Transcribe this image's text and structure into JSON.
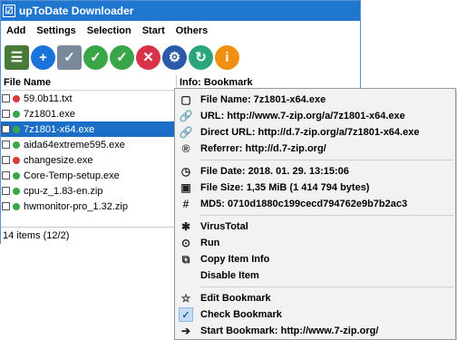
{
  "window": {
    "title": "upToDate Downloader"
  },
  "menubar": {
    "items": [
      "Add",
      "Settings",
      "Selection",
      "Start",
      "Others"
    ]
  },
  "toolbar": {
    "buttons": [
      {
        "icon": "list-icon",
        "color": "#4a7a3a"
      },
      {
        "icon": "add-icon",
        "color": "#1a73d9"
      },
      {
        "icon": "check-list-icon",
        "color": "#7a8a9a"
      },
      {
        "icon": "checkmark-icon",
        "color": "#3aa64a"
      },
      {
        "icon": "checkmark-icon",
        "color": "#3aa64a"
      },
      {
        "icon": "delete-icon",
        "color": "#d9334a"
      },
      {
        "icon": "settings-icon",
        "color": "#2a5aa8"
      },
      {
        "icon": "refresh-icon",
        "color": "#2aa67a"
      },
      {
        "icon": "info-icon",
        "color": "#f09010"
      }
    ]
  },
  "left_pane": {
    "header": "File Name",
    "files": [
      {
        "name": "59.0b11.txt",
        "status_color": "#d93a3a",
        "selected": false
      },
      {
        "name": "7z1801.exe",
        "status_color": "#3aa64a",
        "selected": false
      },
      {
        "name": "7z1801-x64.exe",
        "status_color": "#3aa64a",
        "selected": true
      },
      {
        "name": "aida64extreme595.exe",
        "status_color": "#3aa64a",
        "selected": false
      },
      {
        "name": "changesize.exe",
        "status_color": "#d93a3a",
        "selected": false
      },
      {
        "name": "Core-Temp-setup.exe",
        "status_color": "#3aa64a",
        "selected": false
      },
      {
        "name": "cpu-z_1.83-en.zip",
        "status_color": "#3aa64a",
        "selected": false
      },
      {
        "name": "hwmonitor-pro_1.32.zip",
        "status_color": "#3aa64a",
        "selected": false
      }
    ]
  },
  "right_pane": {
    "header": "Info: Bookmark"
  },
  "statusbar": {
    "text": "14 items (12/2)"
  },
  "context_menu": {
    "groups": [
      [
        {
          "icon": "file-icon",
          "label": "File Name: 7z1801-x64.exe"
        },
        {
          "icon": "link-icon",
          "label": "URL: http://www.7-zip.org/a/7z1801-x64.exe"
        },
        {
          "icon": "link-icon",
          "label": "Direct URL: http://d.7-zip.org/a/7z1801-x64.exe"
        },
        {
          "icon": "referrer-icon",
          "label": "Referrer: http://d.7-zip.org/"
        }
      ],
      [
        {
          "icon": "clock-icon",
          "label": "File Date: 2018. 01. 29. 13:15:06"
        },
        {
          "icon": "disk-icon",
          "label": "File Size: 1,35 MiB (1 414 794 bytes)"
        },
        {
          "icon": "hash-icon",
          "label": "MD5: 0710d1880c199cecd794762e9b7b2ac3"
        }
      ],
      [
        {
          "icon": "bug-icon",
          "label": "VirusTotal"
        },
        {
          "icon": "run-icon",
          "label": "Run"
        },
        {
          "icon": "copy-icon",
          "label": "Copy Item Info"
        },
        {
          "icon": "",
          "label": "Disable Item"
        }
      ],
      [
        {
          "icon": "star-icon",
          "label": "Edit Bookmark"
        },
        {
          "icon": "checkmark-icon",
          "label": "Check Bookmark",
          "checked": true
        },
        {
          "icon": "arrow-right-icon",
          "label": "Start Bookmark: http://www.7-zip.org/"
        }
      ]
    ]
  },
  "colors": {
    "titlebar": "#1f77d0",
    "selection": "#1b6ec6",
    "menu_bg": "#f2f2f2"
  }
}
